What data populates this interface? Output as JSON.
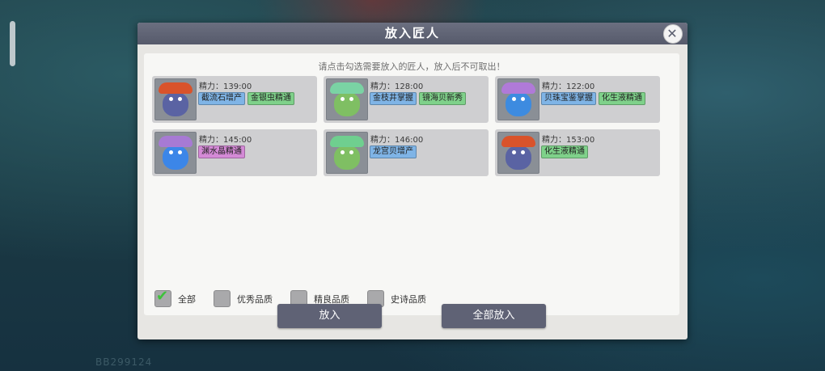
{
  "dialog": {
    "title": "放入匠人",
    "hint": "请点击勾选需要放入的匠人，放入后不可取出！",
    "close_icon": "close-icon"
  },
  "artisans": [
    {
      "stamina": "精力：139:00",
      "hat_color": "#d9532b",
      "face_color": "#5a63a3",
      "tags": [
        {
          "text": "截流石增产",
          "color": "#7fb4e6"
        },
        {
          "text": "金银虫精通",
          "color": "#7fd18a"
        }
      ]
    },
    {
      "stamina": "精力：128:00",
      "hat_color": "#7ad3a4",
      "face_color": "#7fbf63",
      "tags": [
        {
          "text": "金枝井掌握",
          "color": "#7fb4e6"
        },
        {
          "text": "镜海贝新秀",
          "color": "#7fd18a"
        }
      ]
    },
    {
      "stamina": "精力：122:00",
      "hat_color": "#b07ad8",
      "face_color": "#3d8be0",
      "tags": [
        {
          "text": "贝珠宝鉴掌握",
          "color": "#7fb4e6"
        },
        {
          "text": "化生液精通",
          "color": "#7fd18a"
        }
      ]
    },
    {
      "stamina": "精力：145:00",
      "hat_color": "#a77ad4",
      "face_color": "#3c86e8",
      "tags": [
        {
          "text": "渊水晶精通",
          "color": "#d48ad6"
        }
      ]
    },
    {
      "stamina": "精力：146:00",
      "hat_color": "#6fcf8f",
      "face_color": "#7fbf63",
      "tags": [
        {
          "text": "龙宫贝增产",
          "color": "#7fb4e6"
        }
      ]
    },
    {
      "stamina": "精力：153:00",
      "hat_color": "#d9532b",
      "face_color": "#5a63a3",
      "tags": [
        {
          "text": "化生液精通",
          "color": "#7fd18a"
        }
      ]
    }
  ],
  "filters": [
    {
      "label": "全部",
      "checked": true
    },
    {
      "label": "优秀品质",
      "checked": false
    },
    {
      "label": "精良品质",
      "checked": false
    },
    {
      "label": "史诗品质",
      "checked": false
    }
  ],
  "buttons": {
    "place": "放入",
    "place_all": "全部放入"
  },
  "footer_uid": "BB299124"
}
